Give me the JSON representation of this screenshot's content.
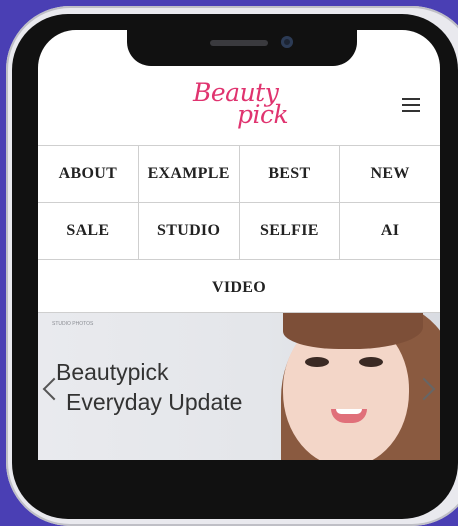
{
  "header": {
    "logo_line1": "Beauty",
    "logo_line2": "pick",
    "menu_icon": "hamburger-menu-icon"
  },
  "nav": {
    "rows": [
      [
        "ABOUT",
        "EXAMPLE",
        "BEST",
        "NEW"
      ],
      [
        "SALE",
        "STUDIO",
        "SELFIE",
        "AI"
      ],
      [
        "VIDEO"
      ]
    ]
  },
  "banner": {
    "small_text": "STUDIO PHOTOS",
    "title_line1": "Beautypick",
    "title_line2": "Everyday Update"
  },
  "colors": {
    "background": "#4a3fb4",
    "logo": "#e0336f"
  }
}
